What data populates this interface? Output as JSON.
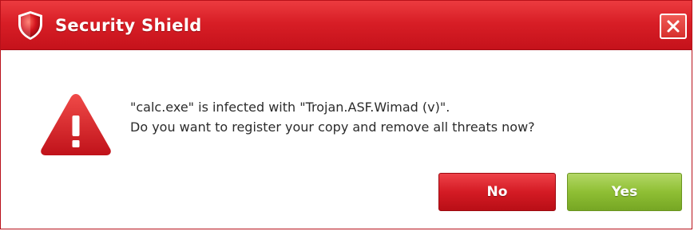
{
  "window": {
    "title": "Security Shield",
    "app_icon": "shield-icon",
    "close_icon": "close-icon",
    "accent_color": "#d81e26"
  },
  "message": {
    "icon": "warning-icon",
    "line1": "\"calc.exe\" is infected with \"Trojan.ASF.Wimad (v)\".",
    "line2": "Do you want to register your copy and remove all threats now?"
  },
  "buttons": {
    "no_label": "No",
    "yes_label": "Yes",
    "no_color": "#d41b24",
    "yes_color": "#8fbf34"
  }
}
